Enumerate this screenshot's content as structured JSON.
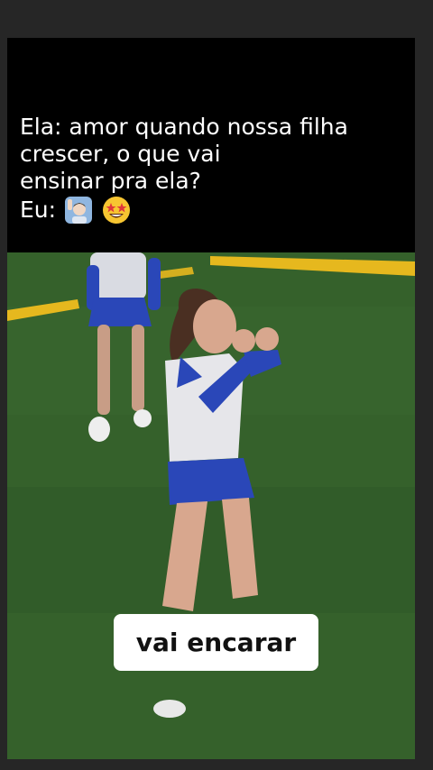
{
  "caption": {
    "lines": [
      "Ela: amor quando nossa filha",
      "crescer, o que vai",
      "ensinar pra ela?",
      "Eu:"
    ],
    "emojis": [
      "man-raising-hand-icon",
      "star-struck-face-icon"
    ]
  },
  "subtitle": {
    "text": "vai encarar"
  },
  "colors": {
    "field_green": "#35612b",
    "line_yellow": "#e6b81e",
    "uniform_blue": "#2a47b8",
    "uniform_white": "#e6e6ea",
    "subtitle_bg": "#ffffff"
  }
}
